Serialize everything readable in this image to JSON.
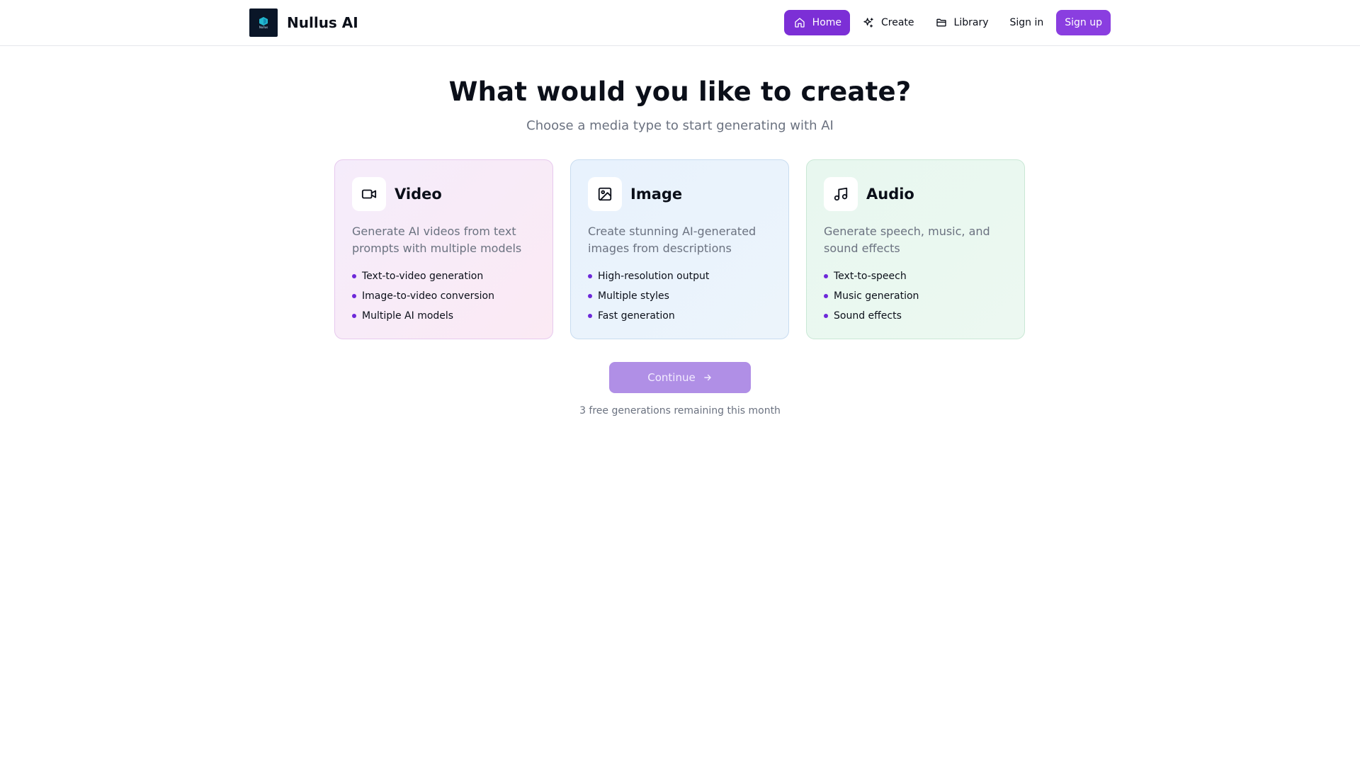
{
  "app": {
    "name": "Nullus AI",
    "logo_text": "Nullus"
  },
  "nav": {
    "items": [
      {
        "label": "Home",
        "icon": "home-icon",
        "active": true
      },
      {
        "label": "Create",
        "icon": "sparkles-icon",
        "active": false
      },
      {
        "label": "Library",
        "icon": "folder-icon",
        "active": false
      }
    ],
    "signin_label": "Sign in",
    "signup_label": "Sign up"
  },
  "main": {
    "title": "What would you like to create?",
    "subtitle": "Choose a media type to start generating with AI",
    "cards": [
      {
        "title": "Video",
        "icon": "video-camera-icon",
        "description": "Generate AI videos from text prompts with multiple models",
        "features": [
          "Text-to-video generation",
          "Image-to-video conversion",
          "Multiple AI models"
        ]
      },
      {
        "title": "Image",
        "icon": "image-icon",
        "description": "Create stunning AI-generated images from descriptions",
        "features": [
          "High-resolution output",
          "Multiple styles",
          "Fast generation"
        ]
      },
      {
        "title": "Audio",
        "icon": "music-note-icon",
        "description": "Generate speech, music, and sound effects",
        "features": [
          "Text-to-speech",
          "Music generation",
          "Sound effects"
        ]
      }
    ],
    "continue_label": "Continue",
    "remaining_text": "3 free generations remaining this month"
  },
  "colors": {
    "accent": "#7c2fd6",
    "continue_disabled": "#b08fe6",
    "bullet": "#6d28d9"
  }
}
